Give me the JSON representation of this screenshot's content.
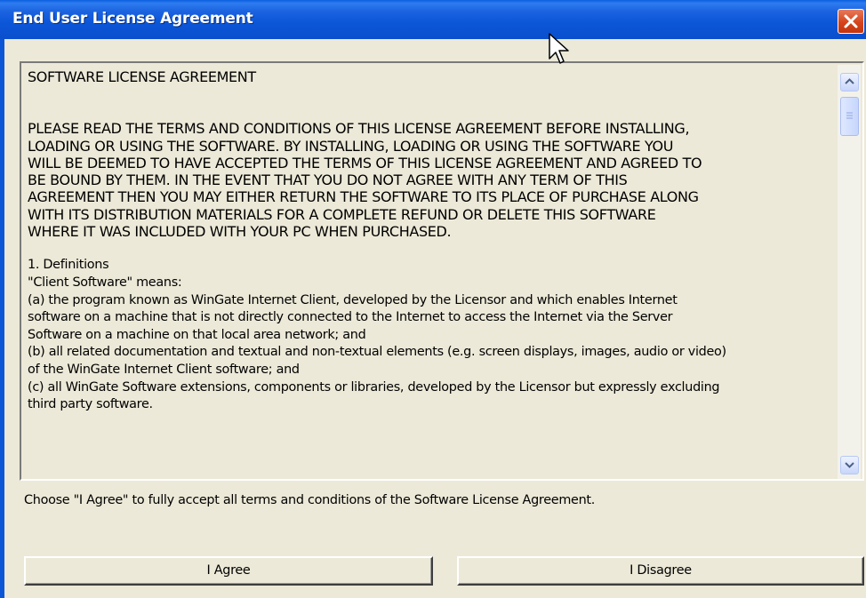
{
  "window": {
    "title": "End User License Agreement"
  },
  "agreement": {
    "heading": "SOFTWARE LICENSE AGREEMENT",
    "caps_lines": [
      "PLEASE READ THE TERMS AND CONDITIONS OF THIS LICENSE AGREEMENT BEFORE INSTALLING,",
      "LOADING OR USING THE SOFTWARE.  BY INSTALLING, LOADING OR USING THE SOFTWARE YOU",
      "WILL BE DEEMED TO HAVE ACCEPTED THE TERMS OF THIS LICENSE AGREEMENT AND AGREED TO",
      "BE BOUND BY THEM.  IN THE EVENT THAT YOU DO NOT AGREE WITH ANY TERM OF THIS",
      "AGREEMENT THEN YOU MAY EITHER RETURN THE SOFTWARE TO ITS PLACE OF PURCHASE ALONG",
      "WITH ITS DISTRIBUTION MATERIALS FOR A COMPLETE REFUND OR DELETE THIS SOFTWARE",
      "WHERE IT WAS INCLUDED WITH YOUR PC WHEN PURCHASED."
    ],
    "body_lines": [
      "1. Definitions",
      "\"Client Software\" means:",
      "(a) the program known as WinGate Internet Client, developed by the Licensor and which enables Internet",
      "software on a machine that is not directly connected to the Internet to access the Internet via the Server",
      "Software on a machine on that local area network; and",
      "(b) all related documentation and textual and non-textual elements (e.g.  screen displays, images, audio or video)",
      "of the WinGate Internet Client software; and",
      "(c) all WinGate Software extensions, components or libraries, developed by the Licensor but expressly excluding",
      "third party software."
    ]
  },
  "instruction": "Choose \"I Agree\" to fully accept all terms and conditions of the Software License Agreement.",
  "buttons": {
    "agree": "I Agree",
    "disagree": "I Disagree"
  },
  "colors": {
    "titlebar": "#0a56d6",
    "close_button": "#d6441c",
    "face": "#ece9d8"
  },
  "icons": [
    "close-icon",
    "scroll-up-arrow-icon",
    "scroll-down-arrow-icon",
    "mouse-pointer-icon"
  ]
}
